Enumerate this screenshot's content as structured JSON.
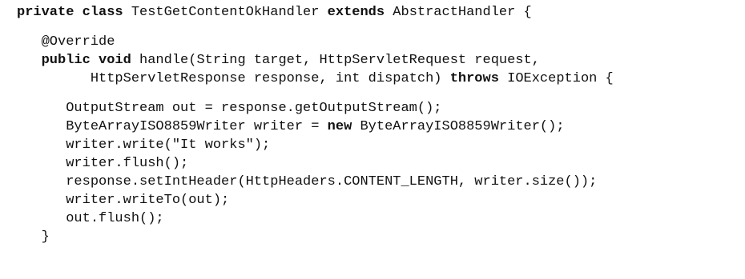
{
  "code": {
    "line1": {
      "kw1": "private class",
      "t1": " TestGetContentOkHandler ",
      "kw2": "extends",
      "t2": " AbstractHandler {"
    },
    "line2": {
      "t1": "   @Override"
    },
    "line3": {
      "kw1": "public void",
      "t1": " handle(String target, HttpServletRequest request,"
    },
    "line4": {
      "t1": "         HttpServletResponse response, int dispatch) ",
      "kw1": "throws",
      "t2": " IOException {"
    },
    "line5": {
      "t1": "      OutputStream out = response.getOutputStream();"
    },
    "line6": {
      "t1": "      ByteArrayISO8859Writer writer = ",
      "kw1": "new",
      "t2": " ByteArrayISO8859Writer();"
    },
    "line7": {
      "t1": "      writer.write(\"It works\");"
    },
    "line8": {
      "t1": "      writer.flush();"
    },
    "line9": {
      "t1": "      response.setIntHeader(HttpHeaders.CONTENT_LENGTH, writer.size());"
    },
    "line10": {
      "t1": "      writer.writeTo(out);"
    },
    "line11": {
      "t1": "      out.flush();"
    },
    "line12": {
      "t1": "   }"
    }
  }
}
